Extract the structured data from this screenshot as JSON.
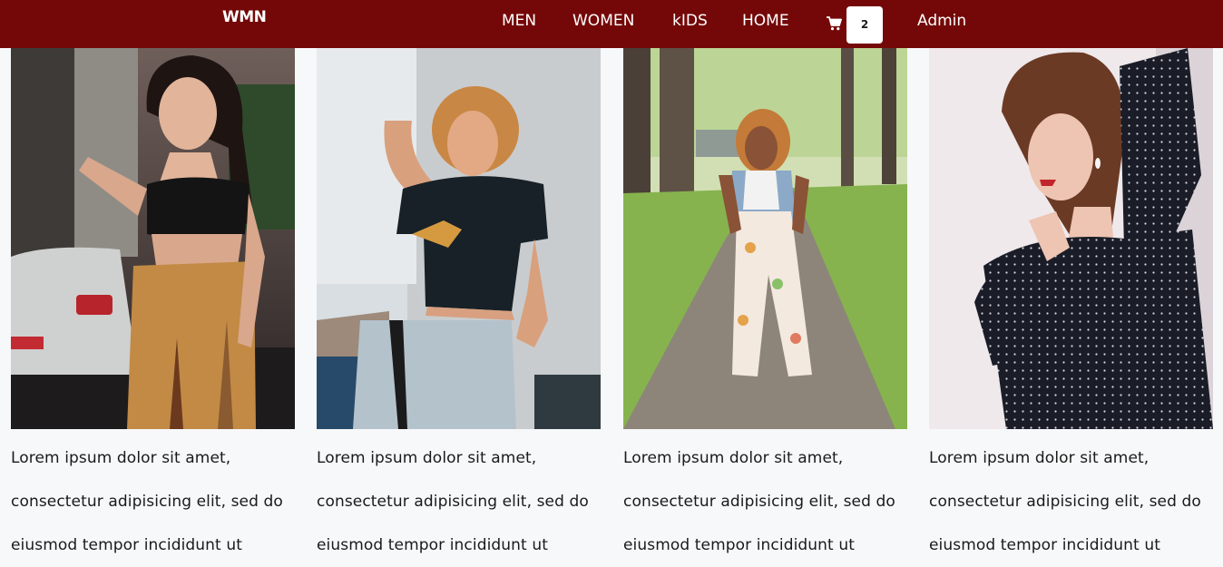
{
  "navbar": {
    "brand": "WMN",
    "links": [
      "MEN",
      "WOMEN",
      "kIDS",
      "HOME"
    ],
    "cart_count": "2",
    "admin_label": "Admin"
  },
  "products": [
    {
      "image": "woman-in-black-crop-top-and-mustard-skirt-photo",
      "description": "Lorem ipsum dolor sit amet, consectetur adipisicing elit, sed do eiusmod tempor incididunt ut"
    },
    {
      "image": "woman-in-black-tee-and-jeans-photo",
      "description": "Lorem ipsum dolor sit amet, consectetur adipisicing elit, sed do eiusmod tempor incididunt ut"
    },
    {
      "image": "woman-in-floral-pants-on-park-path-photo",
      "description": "Lorem ipsum dolor sit amet, consectetur adipisicing elit, sed do eiusmod tempor incididunt ut"
    },
    {
      "image": "woman-in-polka-dot-blouse-photo",
      "description": "Lorem ipsum dolor sit amet, consectetur adipisicing elit, sed do eiusmod tempor incididunt ut"
    }
  ],
  "colors": {
    "navbar": "#740808",
    "page": "#f7f8fa"
  }
}
